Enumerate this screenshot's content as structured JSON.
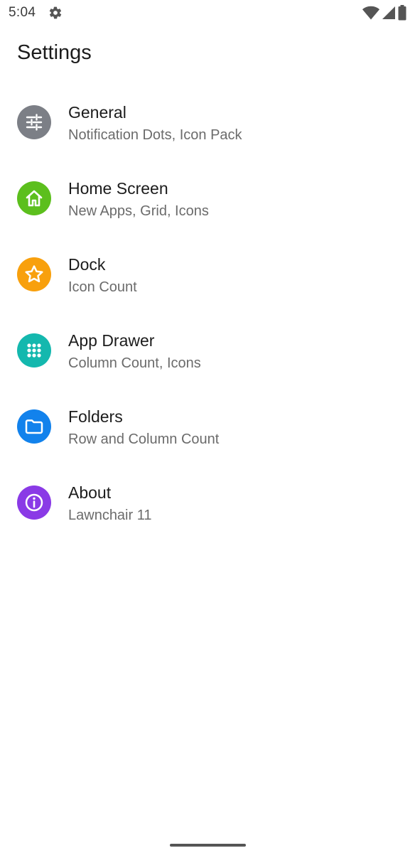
{
  "status_bar": {
    "time": "5:04",
    "icons": [
      "gear-icon",
      "wifi-icon",
      "signal-icon",
      "battery-icon"
    ]
  },
  "page": {
    "title": "Settings"
  },
  "settings": [
    {
      "title": "General",
      "subtitle": "Notification Dots, Icon Pack",
      "icon": "sliders-icon",
      "color": "#7c7f86"
    },
    {
      "title": "Home Screen",
      "subtitle": "New Apps, Grid, Icons",
      "icon": "home-icon",
      "color": "#5cbf1d"
    },
    {
      "title": "Dock",
      "subtitle": "Icon Count",
      "icon": "star-icon",
      "color": "#f8a00d"
    },
    {
      "title": "App Drawer",
      "subtitle": "Column Count, Icons",
      "icon": "grid-dots-icon",
      "color": "#14b8ae"
    },
    {
      "title": "Folders",
      "subtitle": "Row and Column Count",
      "icon": "folder-icon",
      "color": "#1282ec"
    },
    {
      "title": "About",
      "subtitle": "Lawnchair 11",
      "icon": "info-icon",
      "color": "#8a3ae6"
    }
  ]
}
